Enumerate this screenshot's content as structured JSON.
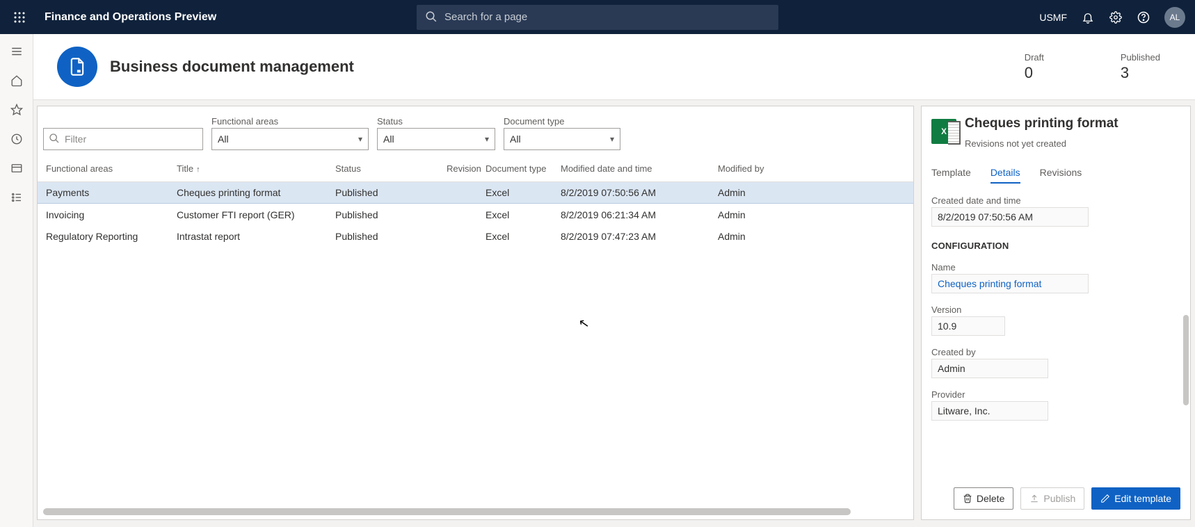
{
  "topbar": {
    "app_title": "Finance and Operations Preview",
    "search_placeholder": "Search for a page",
    "entity": "USMF",
    "avatar_initials": "AL"
  },
  "header": {
    "page_title": "Business document management",
    "stats": {
      "draft_label": "Draft",
      "draft_value": "0",
      "published_label": "Published",
      "published_value": "3"
    }
  },
  "filters": {
    "filter_placeholder": "Filter",
    "functional_areas": {
      "label": "Functional areas",
      "value": "All"
    },
    "status": {
      "label": "Status",
      "value": "All"
    },
    "doc_type": {
      "label": "Document type",
      "value": "All"
    }
  },
  "table": {
    "headers": {
      "func": "Functional areas",
      "title": "Title",
      "status": "Status",
      "revision": "Revision",
      "type": "Document type",
      "date": "Modified date and time",
      "mod": "Modified by"
    },
    "rows": [
      {
        "func": "Payments",
        "title": "Cheques printing format",
        "status": "Published",
        "type": "Excel",
        "date": "8/2/2019 07:50:56 AM",
        "mod": "Admin"
      },
      {
        "func": "Invoicing",
        "title": "Customer FTI report (GER)",
        "status": "Published",
        "type": "Excel",
        "date": "8/2/2019 06:21:34 AM",
        "mod": "Admin"
      },
      {
        "func": "Regulatory Reporting",
        "title": "Intrastat report",
        "status": "Published",
        "type": "Excel",
        "date": "8/2/2019 07:47:23 AM",
        "mod": "Admin"
      }
    ]
  },
  "detail": {
    "title": "Cheques printing format",
    "subtitle": "Revisions not yet created",
    "tabs": {
      "template": "Template",
      "details": "Details",
      "revisions": "Revisions"
    },
    "created_label": "Created date and time",
    "created_value": "8/2/2019 07:50:56 AM",
    "config_section": "CONFIGURATION",
    "name_label": "Name",
    "name_value": "Cheques printing format",
    "version_label": "Version",
    "version_value": "10.9",
    "createdby_label": "Created by",
    "createdby_value": "Admin",
    "provider_label": "Provider",
    "provider_value": "Litware, Inc.",
    "actions": {
      "delete": "Delete",
      "publish": "Publish",
      "edit": "Edit template"
    }
  }
}
